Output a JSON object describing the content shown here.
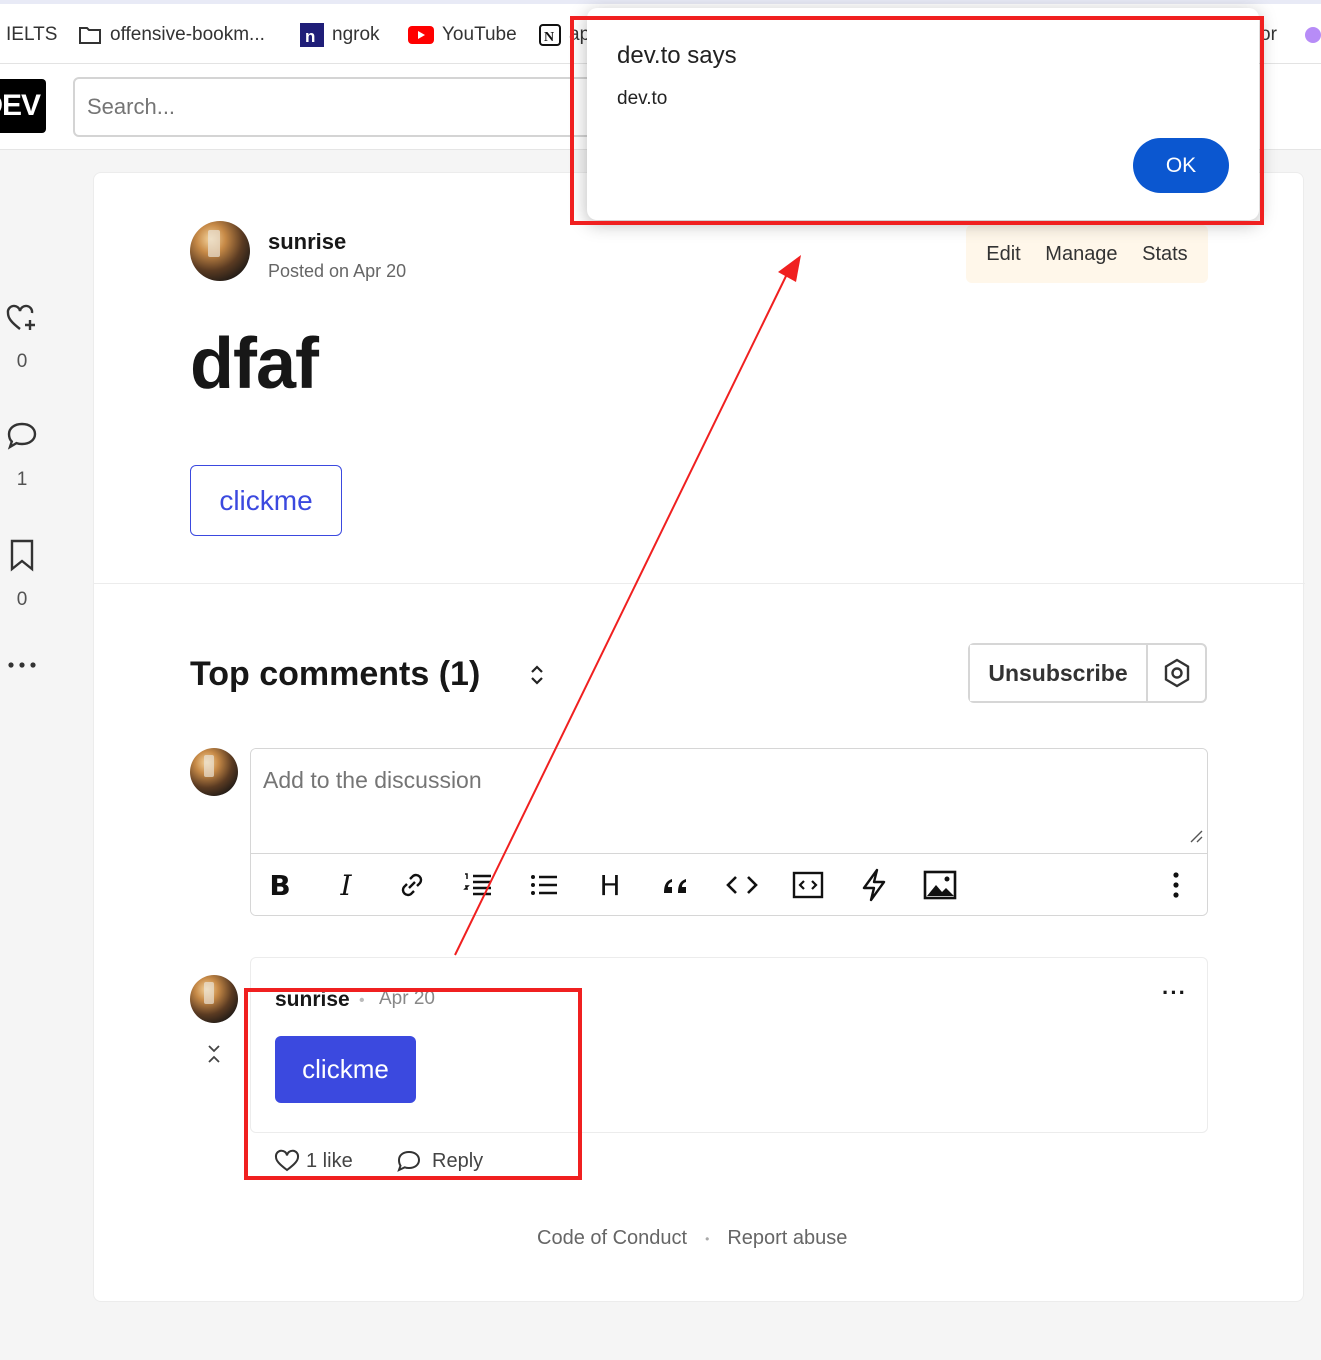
{
  "bookmarks": [
    {
      "label": "IELTS",
      "icon": "none"
    },
    {
      "label": "offensive-bookm...",
      "icon": "folder-icon"
    },
    {
      "label": "ngrok",
      "icon": "ngrok-icon"
    },
    {
      "label": "YouTube",
      "icon": "youtube-icon"
    },
    {
      "label": "ap",
      "icon": "notion-icon"
    },
    {
      "label": "or",
      "icon": "none"
    }
  ],
  "header": {
    "logo": "DEV",
    "search_placeholder": "Search..."
  },
  "rail": {
    "reactions": "0",
    "comments": "1",
    "bookmarks": "0"
  },
  "article": {
    "author": "sunrise",
    "posted": "Posted on Apr 20",
    "actions": [
      "Edit",
      "Manage",
      "Stats"
    ],
    "title": "dfaf",
    "body_button": "clickme"
  },
  "comments": {
    "title": "Top comments (1)",
    "unsubscribe": "Unsubscribe",
    "placeholder": "Add to the discussion",
    "toolbar": {
      "bold": "B",
      "italic": "I",
      "heading": "H"
    },
    "items": [
      {
        "author": "sunrise",
        "date": "Apr 20",
        "button": "clickme",
        "likes": "1 like",
        "reply": "Reply"
      }
    ]
  },
  "footer": {
    "code_of_conduct": "Code of Conduct",
    "report": "Report abuse"
  },
  "dialog": {
    "title": "dev.to says",
    "message": "dev.to",
    "ok": "OK"
  },
  "colors": {
    "accent": "#3b49df",
    "dialog_button": "#0b57d0",
    "annotation": "#f02020"
  }
}
